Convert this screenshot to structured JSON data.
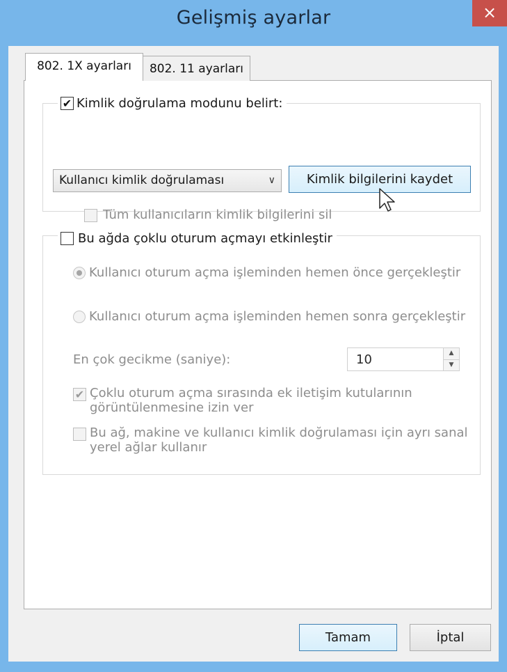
{
  "window": {
    "title": "Gelişmiş ayarlar",
    "close_icon": "×"
  },
  "tabs": [
    {
      "label": "802. 1X ayarları",
      "active": true
    },
    {
      "label": "802. 11 ayarları",
      "active": false
    }
  ],
  "auth_group": {
    "checkbox_label": "Kimlik doğrulama modunu belirt:",
    "checked": true,
    "mode_select": {
      "value": "Kullanıcı kimlik doğrulaması"
    },
    "save_credentials_button": "Kimlik bilgilerini kaydet",
    "delete_all_label": "Tüm kullanıcıların kimlik bilgilerini sil",
    "delete_all_checked": false
  },
  "sso_group": {
    "checkbox_label": "Bu ağda çoklu oturum açmayı etkinleştir",
    "checked": false,
    "radio_before": "Kullanıcı oturum açma işleminden hemen önce gerçekleştir",
    "radio_before_selected": true,
    "radio_after": "Kullanıcı oturum açma işleminden hemen sonra gerçekleştir",
    "radio_after_selected": false,
    "max_delay_label": "En çok gecikme (saniye):",
    "max_delay_value": "10",
    "allow_dialogs_label_line1": "Çoklu oturum açma sırasında ek iletişim kutularının",
    "allow_dialogs_label_line2": "görüntülenmesine izin ver",
    "allow_dialogs_checked": true,
    "separate_vlans_label_line1": "Bu ağ, makine ve kullanıcı kimlik doğrulaması için ayrı sanal",
    "separate_vlans_label_line2": "yerel ağlar kullanır",
    "separate_vlans_checked": false
  },
  "footer": {
    "ok_button": "Tamam",
    "cancel_button": "İptal"
  },
  "colors": {
    "title_bar": "#77b6ea",
    "close_button": "#c7504a",
    "dialog_background": "#f0f0f0",
    "disabled_text": "#8d8d8d"
  }
}
